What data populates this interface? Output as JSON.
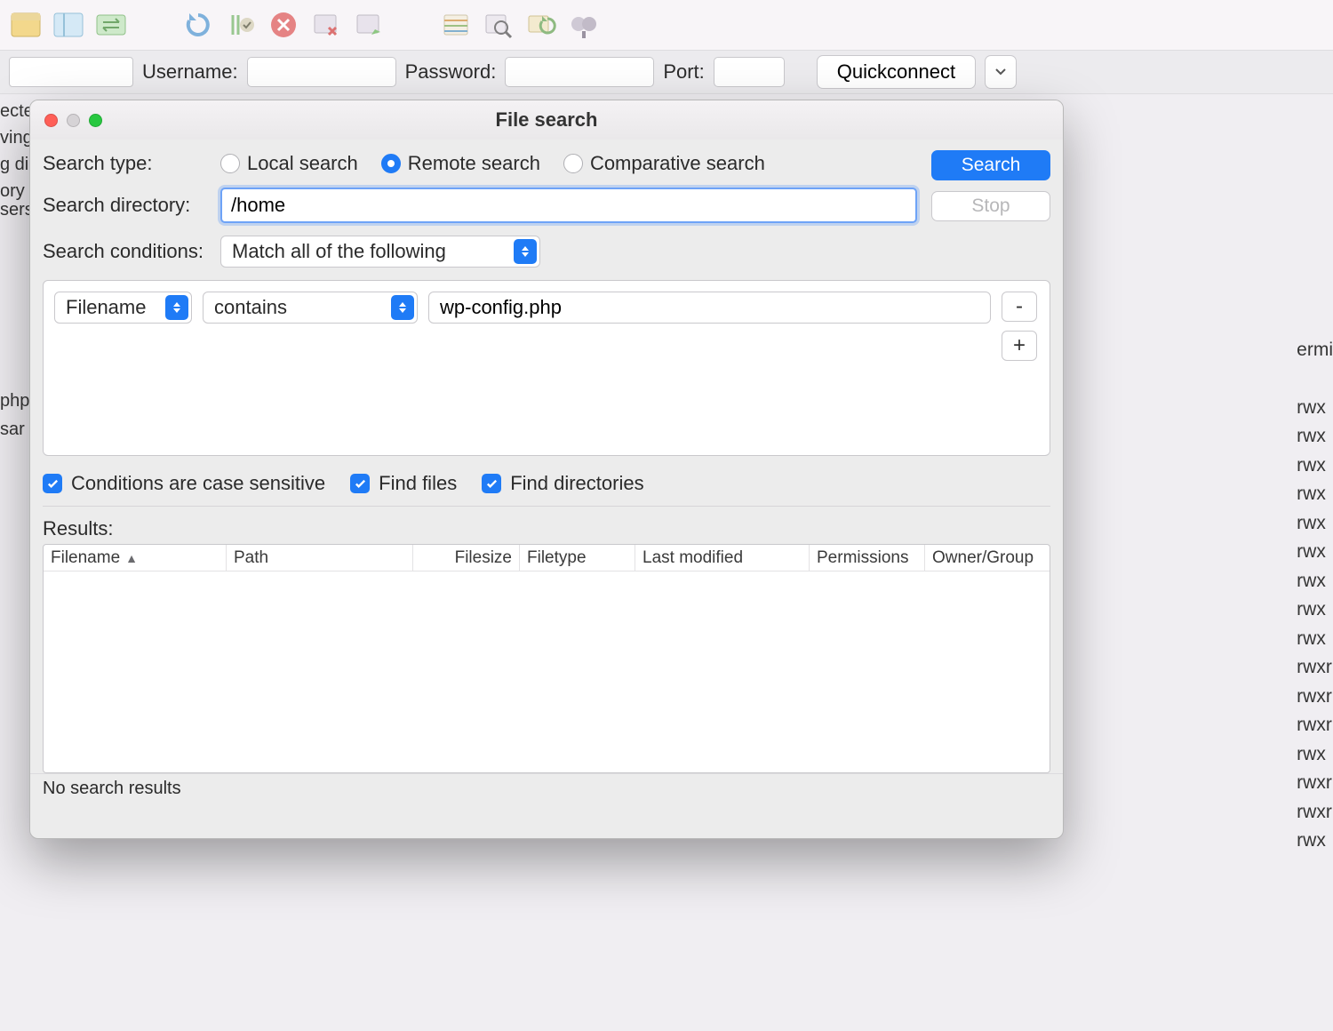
{
  "quickbar": {
    "username_label": "Username:",
    "password_label": "Password:",
    "port_label": "Port:",
    "quickconnect": "Quickconnect"
  },
  "dialog": {
    "title": "File search",
    "search_type_label": "Search type:",
    "radio_local": "Local search",
    "radio_remote": "Remote search",
    "radio_comparative": "Comparative search",
    "search_btn": "Search",
    "stop_btn": "Stop",
    "search_dir_label": "Search directory:",
    "search_dir_value": "/home",
    "search_cond_label": "Search conditions:",
    "match_select": "Match all of the following",
    "cond_field": "Filename",
    "cond_op": "contains",
    "cond_value": "wp-config.php",
    "minus": "-",
    "plus": "+",
    "chk_case": "Conditions are case sensitive",
    "chk_files": "Find files",
    "chk_dirs": "Find directories",
    "results_label": "Results:",
    "cols": {
      "filename": "Filename",
      "path": "Path",
      "filesize": "Filesize",
      "filetype": "Filetype",
      "lastmod": "Last modified",
      "perms": "Permissions",
      "owner": "Owner/Group"
    },
    "status": "No search results"
  },
  "bg": {
    "left1": "ecte",
    "left2": "ving",
    "left3": "g di",
    "left4": "ory",
    "sers": "sers",
    "php": "php",
    "sar": "sar",
    "ermi": "ermi",
    "rwx": "rwx",
    "rwxr": "rwxr",
    "rwxn": "rwxr"
  }
}
